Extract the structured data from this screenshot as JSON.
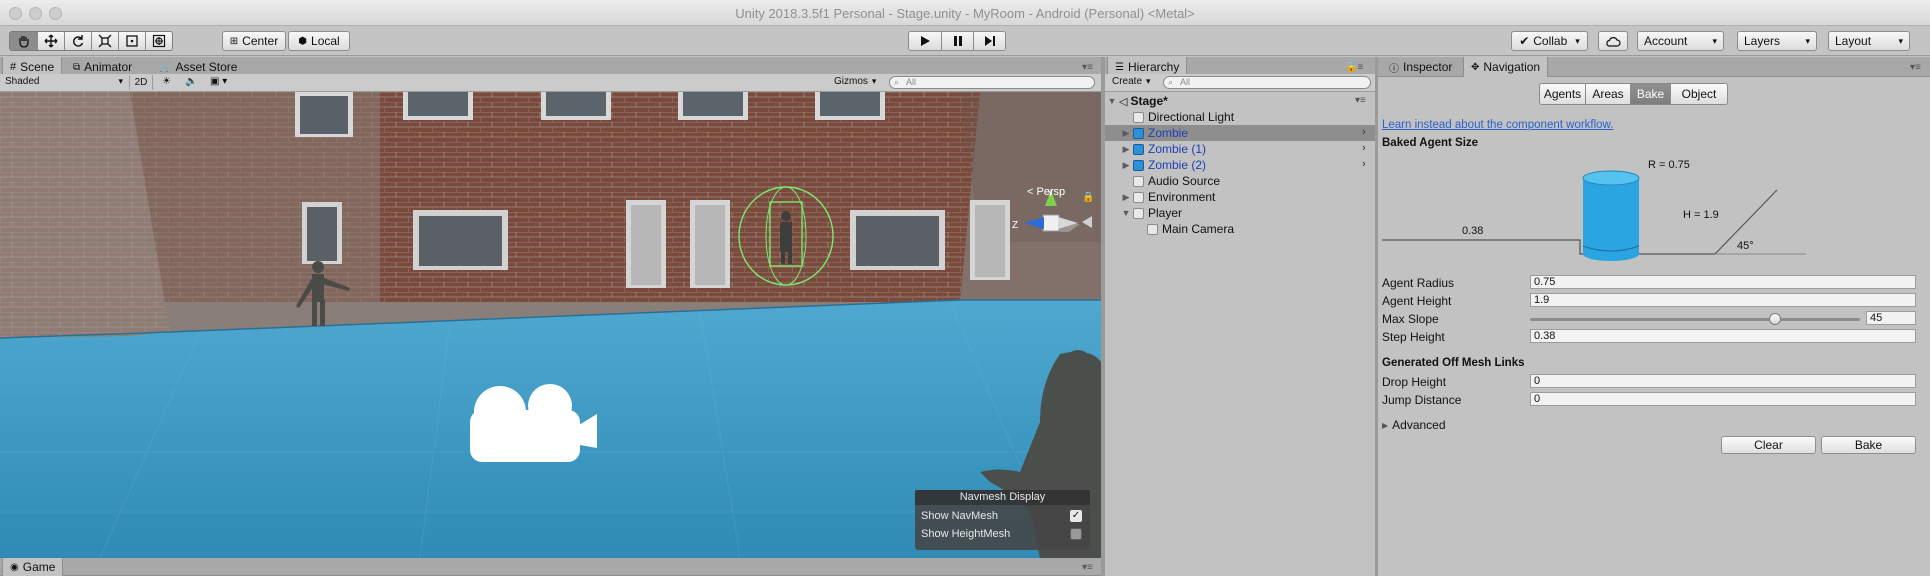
{
  "window": {
    "title": "Unity 2018.3.5f1 Personal - Stage.unity - MyRoom - Android (Personal) <Metal>"
  },
  "toolbar": {
    "tools": [
      "hand-tool-icon",
      "move-tool-icon",
      "rotate-tool-icon",
      "scale-tool-icon",
      "rect-tool-icon",
      "transform-tool-icon"
    ],
    "pivot_label": "Center",
    "space_label": "Local",
    "collab_label": "Collab",
    "account_label": "Account",
    "layers_label": "Layers",
    "layout_label": "Layout"
  },
  "scene_panel": {
    "tabs": [
      {
        "label": "Scene"
      },
      {
        "label": "Animator"
      },
      {
        "label": "Asset Store"
      }
    ],
    "shading_mode": "Shaded",
    "mode_2d": "2D",
    "gizmos_label": "Gizmos",
    "search_placeholder": "All",
    "persp_label": "Persp",
    "axis_z": "Z",
    "axis_y": "Y",
    "navmesh_display": {
      "title": "Navmesh Display",
      "show_navmesh_label": "Show NavMesh",
      "show_navmesh_checked": true,
      "show_heightmesh_label": "Show HeightMesh",
      "show_heightmesh_checked": false
    }
  },
  "game_tab": {
    "label": "Game"
  },
  "hierarchy": {
    "tab_label": "Hierarchy",
    "create_label": "Create",
    "search_placeholder": "All",
    "scene_name": "Stage*",
    "items": [
      {
        "label": "Directional Light"
      },
      {
        "label": "Zombie"
      },
      {
        "label": "Zombie (1)"
      },
      {
        "label": "Zombie (2)"
      },
      {
        "label": "Audio Source"
      },
      {
        "label": "Environment"
      },
      {
        "label": "Player"
      },
      {
        "label": "Main Camera"
      }
    ]
  },
  "inspector": {
    "tabs": [
      {
        "label": "Inspector"
      },
      {
        "label": "Navigation"
      }
    ],
    "segments": [
      {
        "label": "Agents"
      },
      {
        "label": "Areas"
      },
      {
        "label": "Bake"
      },
      {
        "label": "Object"
      }
    ],
    "active_segment": "Bake",
    "workflow_link": "Learn instead about the component workflow.",
    "baked_agent_size_title": "Baked Agent Size",
    "diagram": {
      "r_label": "R = 0.75",
      "h_label": "H = 1.9",
      "step_label": "0.38",
      "slope_label": "45°"
    },
    "fields": {
      "agent_radius": {
        "label": "Agent Radius",
        "value": "0.75"
      },
      "agent_height": {
        "label": "Agent Height",
        "value": "1.9"
      },
      "max_slope": {
        "label": "Max Slope",
        "value": "45",
        "slider_fraction": 0.75
      },
      "step_height": {
        "label": "Step Height",
        "value": "0.38"
      }
    },
    "offmesh_title": "Generated Off Mesh Links",
    "drop_height": {
      "label": "Drop Height",
      "value": "0"
    },
    "jump_distance": {
      "label": "Jump Distance",
      "value": "0"
    },
    "advanced_label": "Advanced",
    "clear_label": "Clear",
    "bake_label": "Bake"
  },
  "colors": {
    "accent": "#3e7de0",
    "navmesh": "#2f9fd4",
    "link": "#2a62c9",
    "selection": "#8e8e8e",
    "prefab_blue": "#1b3fb7"
  }
}
